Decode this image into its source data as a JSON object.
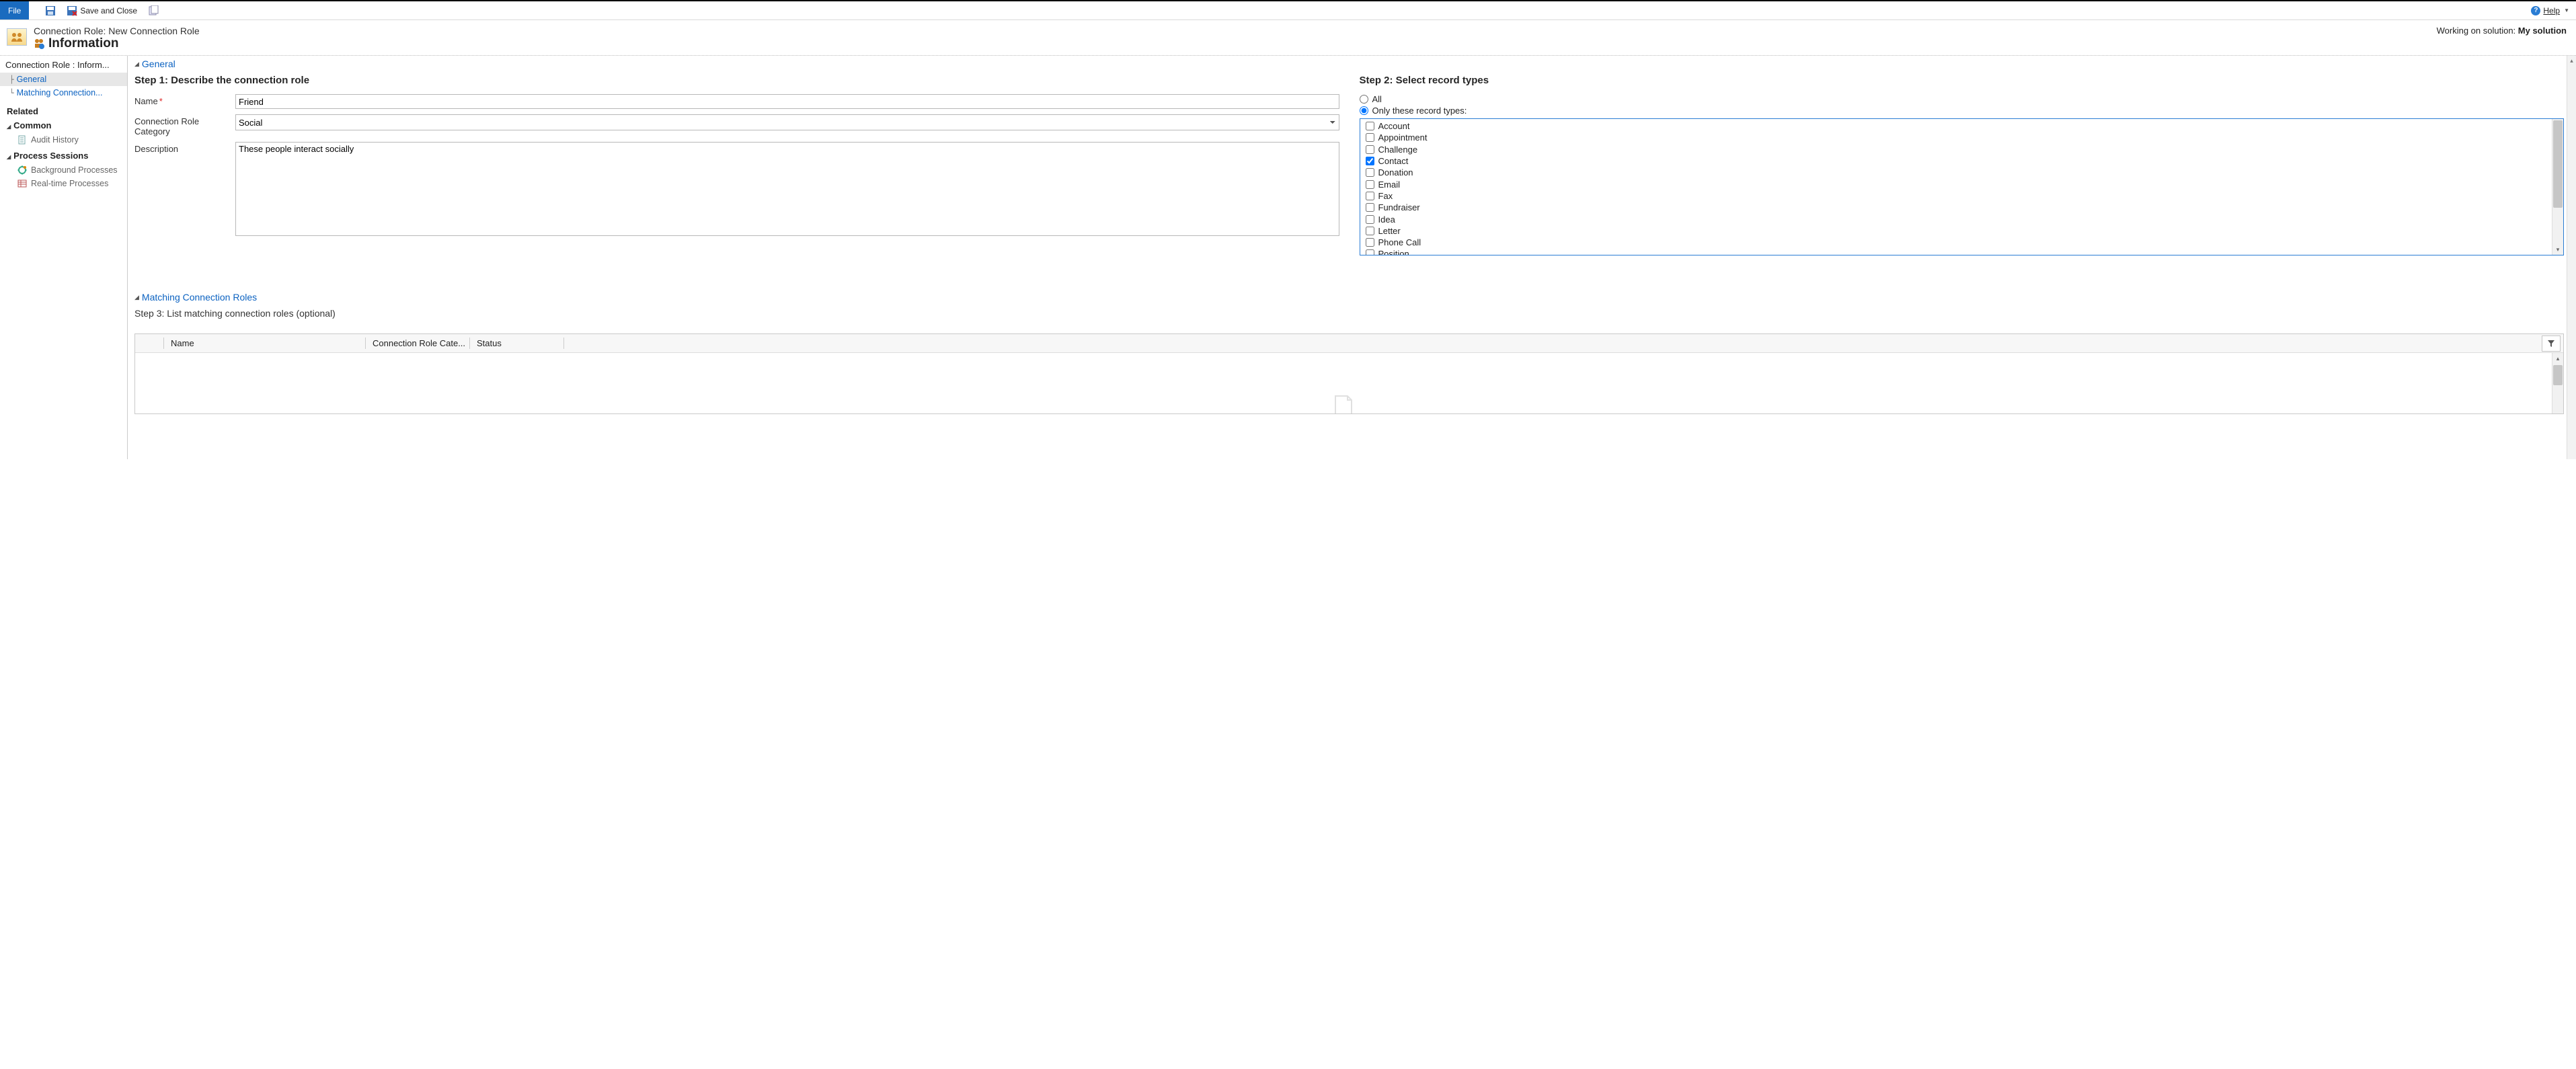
{
  "toolbar": {
    "file": "File",
    "save_close": "Save and Close",
    "help": "Help"
  },
  "header": {
    "crumb": "Connection Role: New Connection Role",
    "title": "Information",
    "working_prefix": "Working on solution: ",
    "working_solution": "My solution"
  },
  "nav": {
    "root": "Connection Role : Inform...",
    "general": "General",
    "matching": "Matching Connection...",
    "related": "Related",
    "common": "Common",
    "audit": "Audit History",
    "process_sessions": "Process Sessions",
    "bg_proc": "Background Processes",
    "rt_proc": "Real-time Processes"
  },
  "general": {
    "section": "General",
    "step1": "Step 1: Describe the connection role",
    "name_label": "Name",
    "name_value": "Friend",
    "cat_label": "Connection Role Category",
    "cat_value": "Social",
    "desc_label": "Description",
    "desc_value": "These people interact socially",
    "step2": "Step 2: Select record types",
    "radio_all": "All",
    "radio_only": "Only these record types:",
    "records": [
      {
        "label": "Account",
        "checked": false
      },
      {
        "label": "Appointment",
        "checked": false
      },
      {
        "label": "Challenge",
        "checked": false
      },
      {
        "label": "Contact",
        "checked": true
      },
      {
        "label": "Donation",
        "checked": false
      },
      {
        "label": "Email",
        "checked": false
      },
      {
        "label": "Fax",
        "checked": false
      },
      {
        "label": "Fundraiser",
        "checked": false
      },
      {
        "label": "Idea",
        "checked": false
      },
      {
        "label": "Letter",
        "checked": false
      },
      {
        "label": "Phone Call",
        "checked": false
      },
      {
        "label": "Position",
        "checked": false
      }
    ]
  },
  "matching": {
    "section": "Matching Connection Roles",
    "step3": "Step 3: List matching connection roles (optional)",
    "col_name": "Name",
    "col_cat": "Connection Role Cate...",
    "col_status": "Status"
  }
}
